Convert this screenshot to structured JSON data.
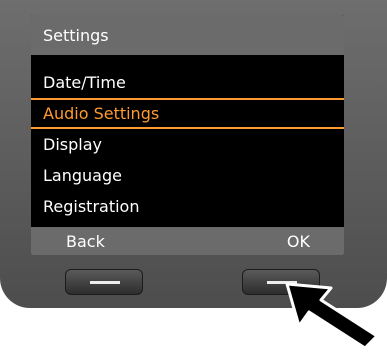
{
  "screen": {
    "title": "Settings",
    "menu": [
      {
        "label": "Date/Time",
        "selected": false
      },
      {
        "label": "Audio Settings",
        "selected": true
      },
      {
        "label": "Display",
        "selected": false
      },
      {
        "label": "Language",
        "selected": false
      },
      {
        "label": "Registration",
        "selected": false
      }
    ],
    "softkeys": {
      "left": "Back",
      "right": "OK"
    }
  },
  "colors": {
    "highlight": "#ff9a2e",
    "header_bg": "#6b6b6b",
    "screen_bg": "#000000",
    "device_body": "#5f5f5f"
  },
  "icons": {
    "pointer": "arrow-pointer-icon"
  }
}
